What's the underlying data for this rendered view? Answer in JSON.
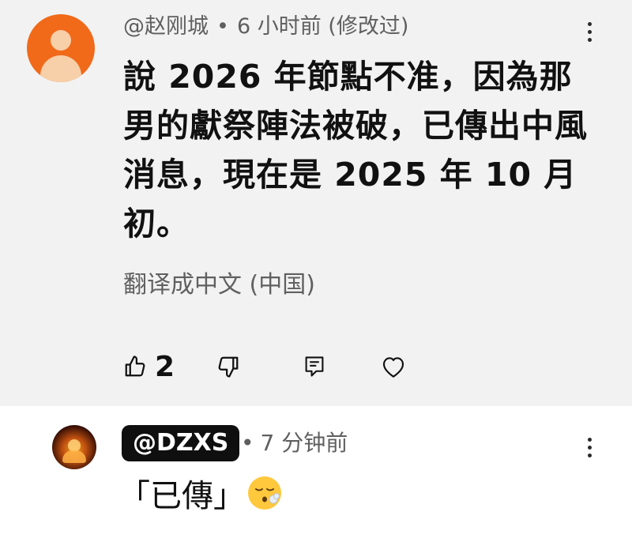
{
  "comments": [
    {
      "author": "@赵刚城",
      "separator": "•",
      "time": "6 小时前 (修改过)",
      "text": "說 2026 年節點不准，因為那男的獻祭陣法被破，已傳出中風消息，現在是 2025 年 10 月初。",
      "translate_label": "翻译成中文 (中国)",
      "like_count": "2"
    },
    {
      "author": "@DZXS",
      "separator": "•",
      "time": "7 分钟前",
      "text": "「已傳」",
      "emoji": "face-exhaling-emoji"
    }
  ],
  "icons": {
    "more": "more-vert-icon",
    "like": "thumbs-up-icon",
    "dislike": "thumbs-down-icon",
    "reply": "reply-icon",
    "heart": "heart-icon"
  },
  "colors": {
    "highlight_bg": "#f2f2f2",
    "avatar1": "#f06a1a",
    "tag_bg": "#0f0f0f"
  }
}
